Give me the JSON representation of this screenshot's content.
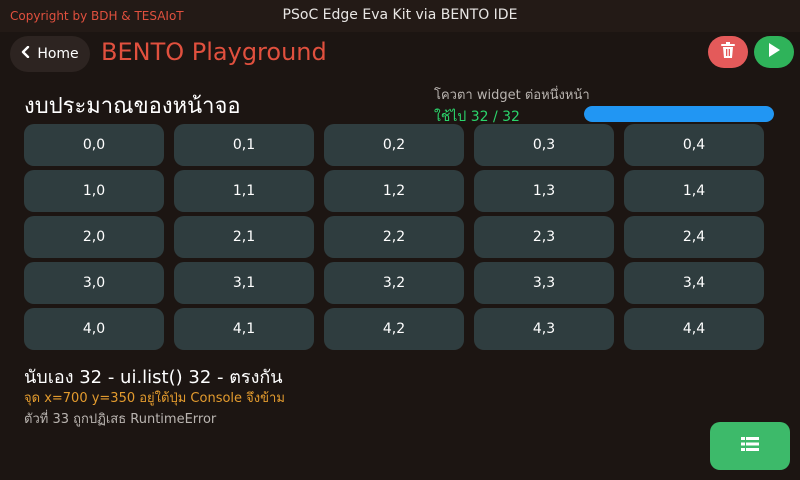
{
  "header": {
    "copyright": "Copyright by BDH & TESAIoT",
    "title": "PSoC Edge Eva Kit via BENTO IDE"
  },
  "nav": {
    "home_label": "Home",
    "app_title": "BENTO Playground"
  },
  "main": {
    "heading": "งบประมาณของหน้าจอ",
    "quota_label": "โควตา widget ต่อหนึ่งหน้า",
    "quota_used": "ใช้ไป 32 / 32",
    "quota_fraction": 1.0,
    "grid": [
      [
        "0,0",
        "0,1",
        "0,2",
        "0,3",
        "0,4"
      ],
      [
        "1,0",
        "1,1",
        "1,2",
        "1,3",
        "1,4"
      ],
      [
        "2,0",
        "2,1",
        "2,2",
        "2,3",
        "2,4"
      ],
      [
        "3,0",
        "3,1",
        "3,2",
        "3,3",
        "3,4"
      ],
      [
        "4,0",
        "4,1",
        "4,2",
        "4,3",
        "4,4"
      ]
    ],
    "count_line": "นับเอง 32 - ui.list() 32 - ตรงกัน",
    "warn_line": "จุด x=700 y=350 อยู่ใต้ปุ่ม Console จึงข้าม",
    "error_line": "ตัวที่ 33 ถูกปฏิเสธ RuntimeError"
  },
  "icons": {
    "back": "chevron-left-icon",
    "delete": "trash-icon",
    "run": "play-icon",
    "console": "list-icon"
  },
  "colors": {
    "background": "#1c1512",
    "accent": "#e0503e",
    "cell": "#2f3d3f",
    "progress": "#2196f3",
    "success": "#2bd46b",
    "warning": "#e39b2e",
    "delete_button": "#e45a5a",
    "run_button": "#2fb35a",
    "console_button": "#3dba6a"
  }
}
